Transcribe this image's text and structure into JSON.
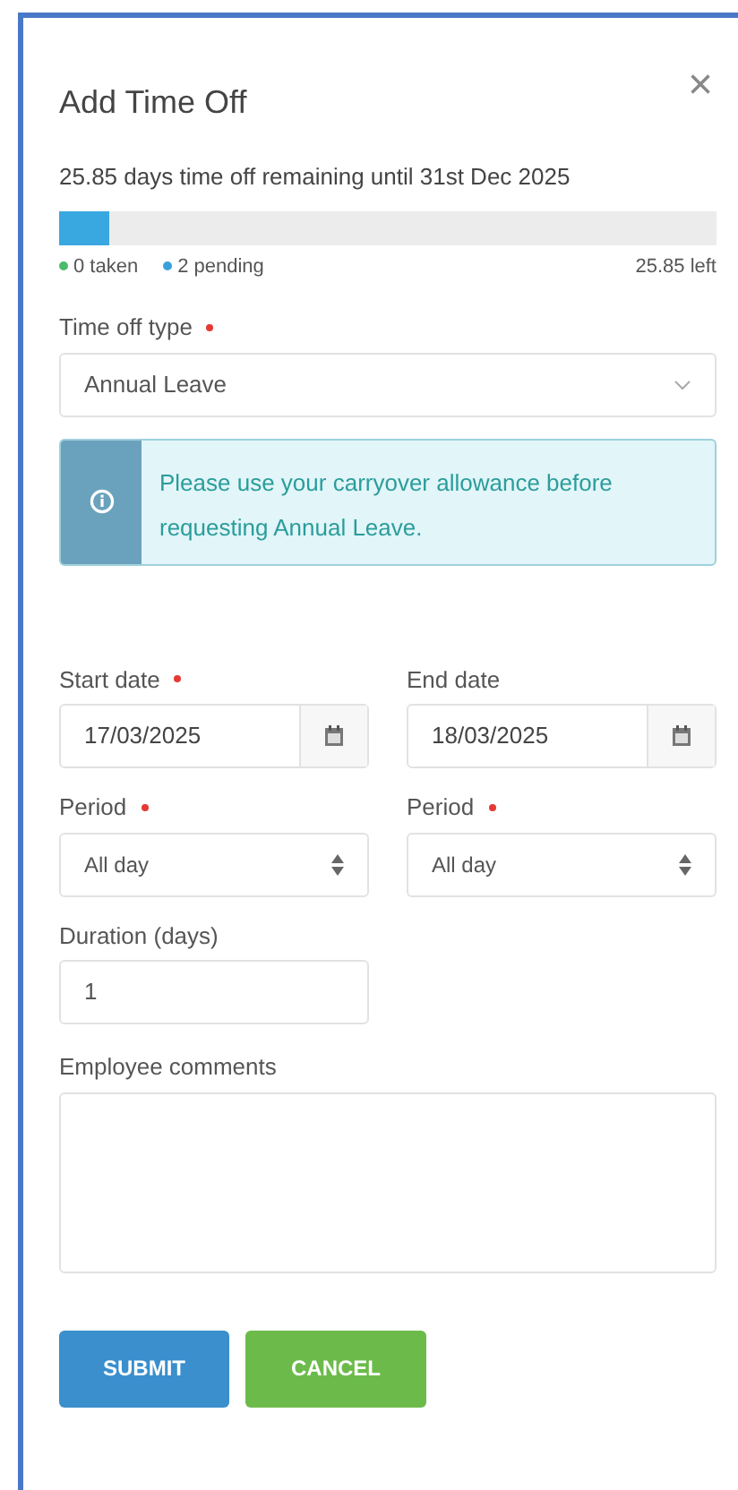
{
  "dialog": {
    "title": "Add Time Off",
    "close_glyph": "×"
  },
  "balance": {
    "summary": "25.85 days time off remaining until 31st Dec 2025",
    "level": 0.075,
    "legend": [
      {
        "label": "0 taken",
        "color": "#4cbb6c"
      },
      {
        "label": "2 pending",
        "color": "#3aa0dc"
      }
    ],
    "remaining": "25.85 left"
  },
  "type_field": {
    "label": "Time off type",
    "required": true,
    "value": "Annual Leave"
  },
  "notice": {
    "text": "Please use your carryover allowance before requesting Annual Leave."
  },
  "date_fields": [
    {
      "label": "Start date",
      "required": true,
      "value": "17/03/2025"
    },
    {
      "label": "End date",
      "required": false,
      "value": "18/03/2025"
    }
  ],
  "period_fields": [
    {
      "label": "Period",
      "required": true,
      "value": "All day"
    },
    {
      "label": "Period",
      "required": true,
      "value": "All day"
    }
  ],
  "duration": {
    "label": "Duration (days)",
    "value": "1"
  },
  "comments": {
    "label": "Employee comments"
  },
  "buttons": [
    {
      "label": "SUBMIT",
      "kind": "primary"
    },
    {
      "label": "CANCEL",
      "kind": "secondary"
    }
  ]
}
